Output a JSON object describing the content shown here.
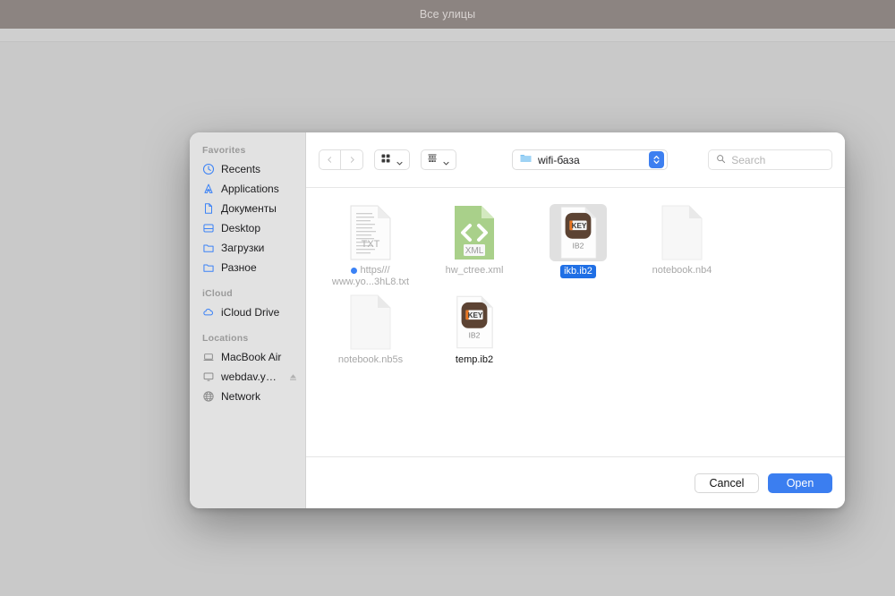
{
  "background": {
    "window_title": "Все улицы",
    "titlebar_color": "#8c8481"
  },
  "dialog": {
    "sidebar": {
      "groups": [
        {
          "title": "Favorites",
          "items": [
            {
              "label": "Recents",
              "icon": "clock-icon"
            },
            {
              "label": "Applications",
              "icon": "applications-icon"
            },
            {
              "label": "Документы",
              "icon": "document-icon"
            },
            {
              "label": "Desktop",
              "icon": "desktop-icon"
            },
            {
              "label": "Загрузки",
              "icon": "folder-icon"
            },
            {
              "label": "Разное",
              "icon": "folder-icon"
            }
          ]
        },
        {
          "title": "iCloud",
          "items": [
            {
              "label": "iCloud Drive",
              "icon": "cloud-icon"
            }
          ]
        },
        {
          "title": "Locations",
          "items": [
            {
              "label": "MacBook Air",
              "icon": "laptop-icon"
            },
            {
              "label": "webdav.yan...",
              "icon": "display-icon",
              "eject": true
            },
            {
              "label": "Network",
              "icon": "globe-icon"
            }
          ]
        }
      ]
    },
    "toolbar": {
      "back_icon": "chevron-left-icon",
      "forward_icon": "chevron-right-icon",
      "icon_view_icon": "grid-view-icon",
      "group_view_icon": "group-view-icon",
      "path_label": "wifi-база",
      "path_folder_icon": "folder-icon",
      "stepper_icon": "chevron-up-down-icon",
      "search_icon": "search-icon",
      "search_placeholder": "Search",
      "search_value": ""
    },
    "files": [
      {
        "name": "https/// www.yo...3hL8.txt",
        "name_line1": "https///",
        "name_line2": "www.yo...3hL8.txt",
        "kind": "txt",
        "badge": "TXT",
        "selected": false,
        "enabled": false,
        "tag_color": "#3b82f6"
      },
      {
        "name": "hw_ctree.xml",
        "kind": "xml",
        "badge": "XML",
        "selected": false,
        "enabled": false
      },
      {
        "name": "ikb.ib2",
        "kind": "ib2",
        "badge": "IB2",
        "selected": true,
        "enabled": true
      },
      {
        "name": "notebook.nb4",
        "kind": "blank",
        "badge": "",
        "selected": false,
        "enabled": false
      },
      {
        "name": "notebook.nb5s",
        "kind": "blank",
        "badge": "",
        "selected": false,
        "enabled": false
      },
      {
        "name": "temp.ib2",
        "kind": "ib2",
        "badge": "IB2",
        "selected": false,
        "enabled": true
      }
    ],
    "footer": {
      "cancel_label": "Cancel",
      "open_label": "Open",
      "open_color": "#3b7ef0"
    }
  }
}
